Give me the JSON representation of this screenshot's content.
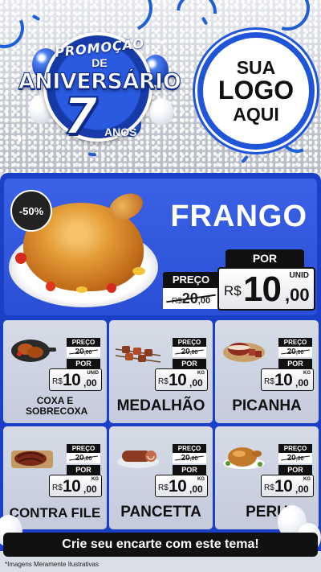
{
  "header": {
    "promo_word": "PROMOÇÃO",
    "promo_de": "DE",
    "promo_anniversary": "ANIVERSÁRIO",
    "promo_number": "7",
    "promo_anos": "ANOS",
    "logo_line1": "SUA",
    "logo_line2": "LOGO",
    "logo_line3": "AQUI"
  },
  "colors": {
    "primary_blue": "#1c3fc8",
    "hero_blue": "#2a4fd6",
    "card_gray": "#cfd4e2",
    "dark": "#111111"
  },
  "featured": {
    "discount_badge": "-50%",
    "name": "FRANGO",
    "preco_label": "PREÇO",
    "old_price_currency": "R$",
    "old_price_int": "20",
    "old_price_cents": ",00",
    "por_label": "POR",
    "currency": "R$",
    "price_int": "10",
    "price_cents": ",00",
    "unit": "UNID"
  },
  "products": [
    {
      "name": "COXA E SOBRECOXA",
      "preco_label": "PREÇO",
      "old_price": "20",
      "old_cents": ",00",
      "por_label": "POR",
      "currency": "R$",
      "price_int": "10",
      "price_cents": ",00",
      "unit": "UNID",
      "icon": "chicken-thighs-pan-icon"
    },
    {
      "name": "MEDALHÃO",
      "preco_label": "PREÇO",
      "old_price": "20",
      "old_cents": ",00",
      "por_label": "POR",
      "currency": "R$",
      "price_int": "10",
      "price_cents": ",00",
      "unit": "KG",
      "icon": "skewers-icon"
    },
    {
      "name": "PICANHA",
      "preco_label": "PREÇO",
      "old_price": "20",
      "old_cents": ",00",
      "por_label": "POR",
      "currency": "R$",
      "price_int": "10",
      "price_cents": ",00",
      "unit": "KG",
      "icon": "picanha-board-icon"
    },
    {
      "name": "CONTRA FILE",
      "preco_label": "PREÇO",
      "old_price": "20",
      "old_cents": ",00",
      "por_label": "POR",
      "currency": "R$",
      "price_int": "10",
      "price_cents": ",00",
      "unit": "KG",
      "icon": "steak-board-icon"
    },
    {
      "name": "PANCETTA",
      "preco_label": "PREÇO",
      "old_price": "20",
      "old_cents": ",00",
      "por_label": "POR",
      "currency": "R$",
      "price_int": "10",
      "price_cents": ",00",
      "unit": "KG",
      "icon": "pancetta-roll-icon"
    },
    {
      "name": "PERU",
      "preco_label": "PREÇO",
      "old_price": "20",
      "old_cents": ",00",
      "por_label": "POR",
      "currency": "R$",
      "price_int": "10",
      "price_cents": ",00",
      "unit": "KG",
      "icon": "roast-turkey-icon"
    }
  ],
  "footer": {
    "cta": "Crie seu encarte com este tema!",
    "disclaimer": "*Imagens Meramente Ilustrativas"
  }
}
